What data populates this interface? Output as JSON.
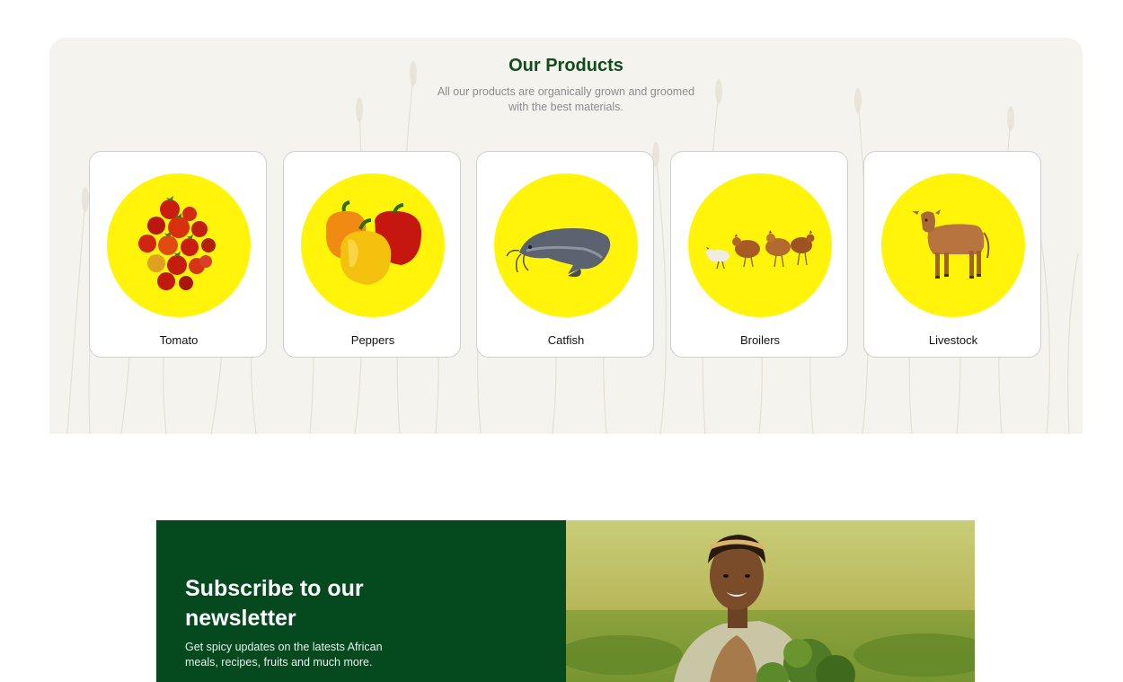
{
  "products": {
    "title": "Our Products",
    "subtitle": "All our products are organically grown and groomed with the best materials.",
    "items": [
      {
        "label": "Tomato",
        "icon": "tomato-image"
      },
      {
        "label": "Peppers",
        "icon": "peppers-image"
      },
      {
        "label": "Catfish",
        "icon": "catfish-image"
      },
      {
        "label": "Broilers",
        "icon": "broilers-image"
      },
      {
        "label": "Livestock",
        "icon": "livestock-image"
      }
    ],
    "colors": {
      "title": "#0f4d1d",
      "circle": "#fff40a",
      "section_bg": "#f5f3ee"
    }
  },
  "newsletter": {
    "title": "Subscribe to our newsletter",
    "description": "Get spicy updates on the latests African meals, recipes, fruits and much more.",
    "image": "farmer-woman-photo",
    "colors": {
      "panel_bg": "#05491f"
    }
  }
}
